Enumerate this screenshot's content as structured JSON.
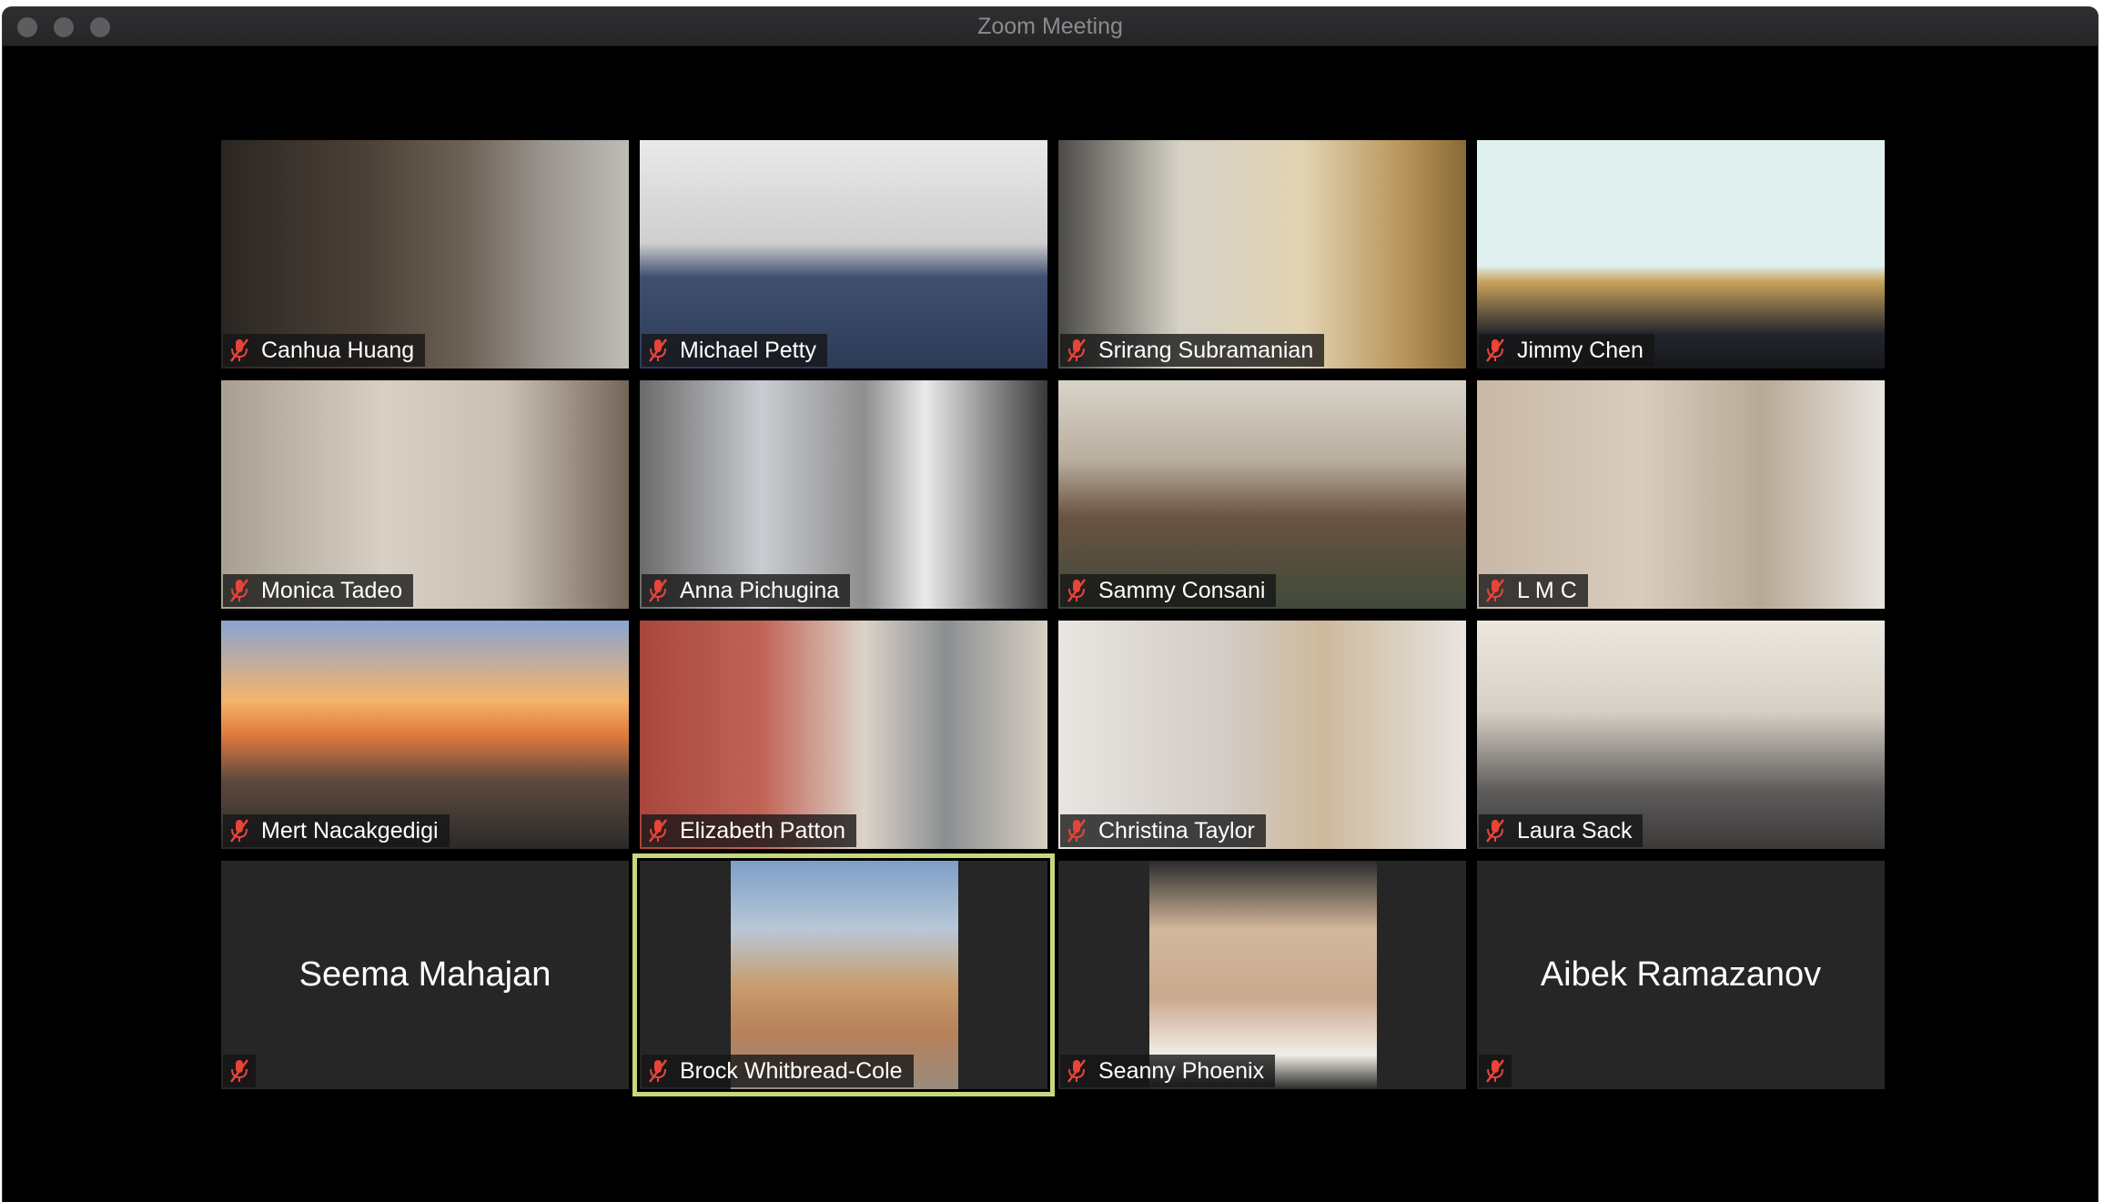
{
  "window": {
    "title": "Zoom Meeting"
  },
  "participants": [
    {
      "name": "Canhua Huang",
      "muted": true,
      "video": true
    },
    {
      "name": "Michael Petty",
      "muted": true,
      "video": true
    },
    {
      "name": "Srirang Subramanian",
      "muted": true,
      "video": true
    },
    {
      "name": "Jimmy Chen",
      "muted": true,
      "video": true
    },
    {
      "name": "Monica Tadeo",
      "muted": true,
      "video": true
    },
    {
      "name": "Anna Pichugina",
      "muted": true,
      "video": true
    },
    {
      "name": "Sammy Consani",
      "muted": true,
      "video": true
    },
    {
      "name": "L M C",
      "muted": true,
      "video": true
    },
    {
      "name": "Mert Nacakgedigi",
      "muted": true,
      "video": true
    },
    {
      "name": "Elizabeth Patton",
      "muted": true,
      "video": true
    },
    {
      "name": "Christina Taylor",
      "muted": true,
      "video": true
    },
    {
      "name": "Laura Sack",
      "muted": true,
      "video": true
    },
    {
      "name": "Seema Mahajan",
      "muted": true,
      "video": false
    },
    {
      "name": "Brock Whitbread-Cole",
      "muted": true,
      "video": true,
      "active_speaker": true
    },
    {
      "name": "Seanny Phoenix",
      "muted": true,
      "video": true
    },
    {
      "name": "Aibek Ramazanov",
      "muted": true,
      "video": false
    }
  ],
  "colors": {
    "active_speaker_border": "#c6d77e",
    "muted_icon": "#e8443a",
    "tile_bg": "#262626"
  }
}
